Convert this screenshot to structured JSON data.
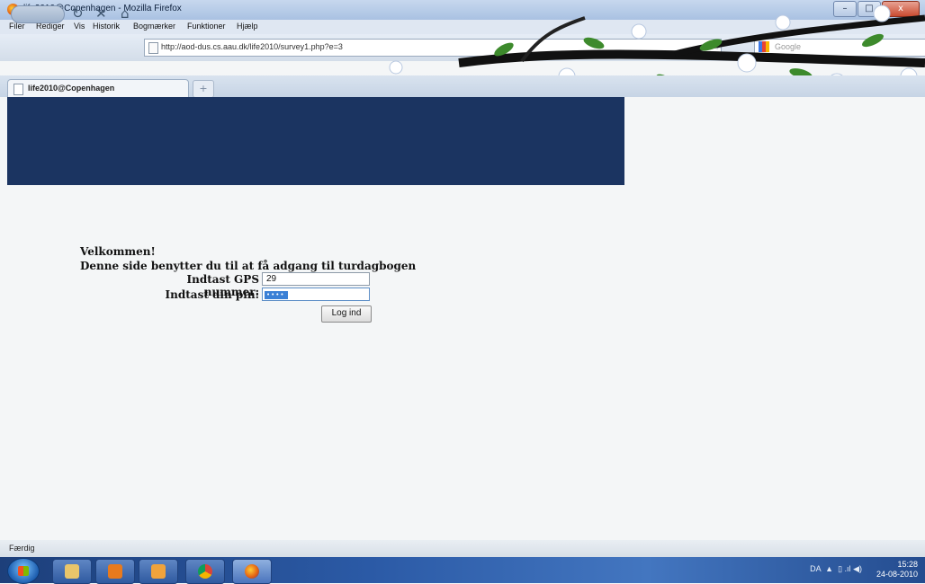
{
  "window": {
    "title": "life2010@Copenhagen - Mozilla Firefox",
    "controls": {
      "minimize": "–",
      "maximize": "□",
      "close": "x"
    }
  },
  "menu": [
    "Filer",
    "Rediger",
    "Vis",
    "Historik",
    "Bogmærker",
    "Funktioner",
    "Hjælp"
  ],
  "navigation": {
    "reload_icon": "reload-icon",
    "stop_icon": "stop-icon",
    "home_icon": "home-icon",
    "url": "http://aod-dus.cs.aau.dk/life2010/survey1.php?e=3",
    "search_placeholder": "Google"
  },
  "tabs": [
    {
      "label": "life2010@Copenhagen",
      "active": true
    }
  ],
  "new_tab_label": "+",
  "page": {
    "banner_color": "#1b3461",
    "welcome": "Velkommen!",
    "intro": "Denne side benytter du til at få adgang til turdagbogen",
    "gps_label": "Indtast GPS nummer:",
    "gps_value": "29",
    "pin_label": "Indtast din pin:",
    "pin_masked": "••••",
    "login_button": "Log ind"
  },
  "status": "Færdig",
  "taskbar": {
    "apps": [
      "windows-explorer",
      "media-player",
      "app",
      "chrome",
      "firefox"
    ],
    "language": "DA",
    "time": "15:28",
    "date": "24-08-2010"
  }
}
